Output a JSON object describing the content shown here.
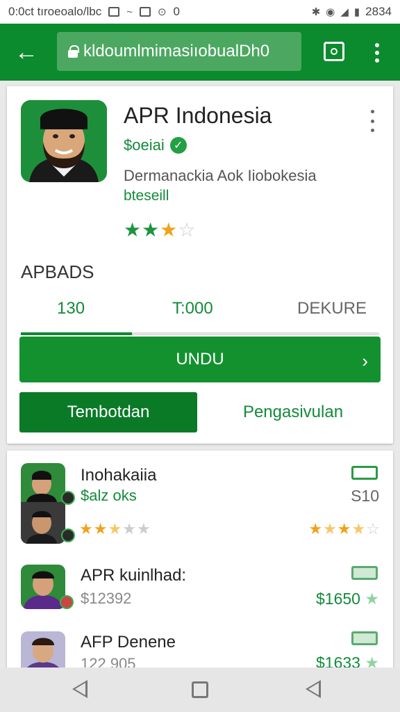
{
  "status_bar": {
    "time_text": "0:0ct tıroeoalo/lbc",
    "icons": [
      "notification-icon",
      "media-icon",
      "photo-icon",
      "sync-icon",
      "bluetooth-icon",
      "wifi-icon",
      "signal-icon",
      "battery-icon"
    ],
    "battery_text": "2834",
    "small_text": "0"
  },
  "app_bar": {
    "url": "kldoumlmimasiıobualDh0",
    "back_icon": "arrow-left-icon",
    "tab_icon": "tabs-icon",
    "menu_icon": "more-vert-icon",
    "color": "#0b8a2e"
  },
  "app": {
    "title": "APR Indonesia",
    "developer": "$oeiai",
    "description": "Dermanackia Aok Iiobokesia",
    "category": "bteseill",
    "rating": 3,
    "max_rating": 4
  },
  "stats": {
    "section_label": "APBADS",
    "values": [
      "130",
      "T:000",
      "DEKURE"
    ],
    "progress_fraction": 0.31
  },
  "buttons": {
    "install_label": "UNDU",
    "tab_active_label": "Tembotdan",
    "tab_other_label": "Pengasivulan"
  },
  "list": [
    {
      "title": "Inohakaiia",
      "subtitle": "$alz oks",
      "rating": 2.5,
      "price": "S10",
      "right_rating": 3.5
    },
    {
      "title": "APR kuinlhad:",
      "subtitle": "$12392",
      "price": "$1650"
    },
    {
      "title": "AFP Denene",
      "subtitle": "122 905",
      "price": "$1633"
    }
  ],
  "nav": {
    "back_icon": "nav-back-icon",
    "home_icon": "nav-home-icon",
    "recent_icon": "nav-recent-icon"
  },
  "colors": {
    "primary": "#0b8a2e",
    "accent": "#14912f",
    "star_green": "#1e9440",
    "star_gold": "#f0a21a"
  }
}
